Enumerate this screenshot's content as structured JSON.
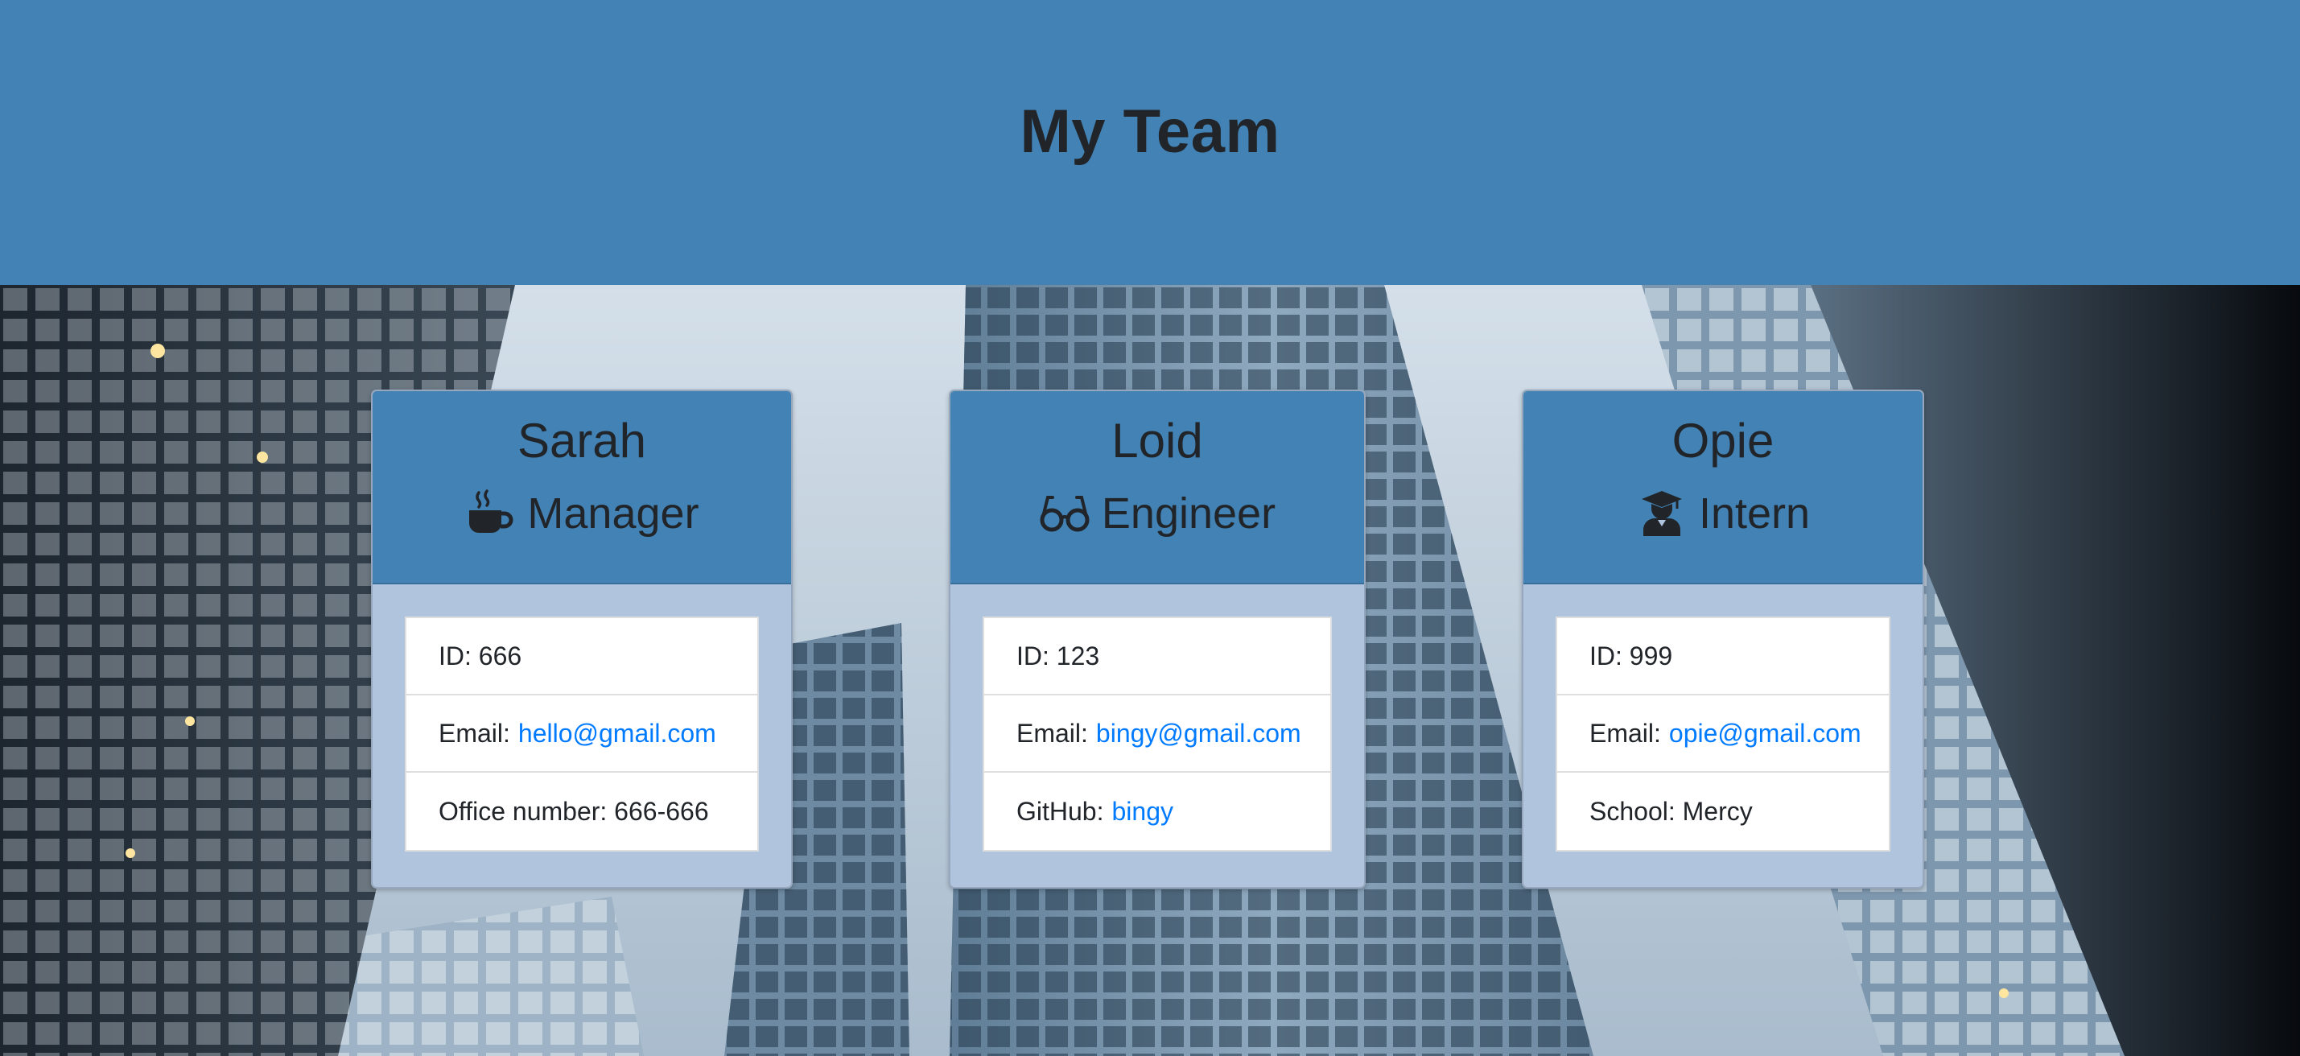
{
  "header": {
    "title": "My Team"
  },
  "team": [
    {
      "name": "Sarah",
      "role": "Manager",
      "icon": "mug-icon",
      "id_label": "ID:",
      "id": "666",
      "email_label": "Email:",
      "email": "hello@gmail.com",
      "extra_label": "Office number:",
      "extra_value": "666-666",
      "extra_is_link": false
    },
    {
      "name": "Loid",
      "role": "Engineer",
      "icon": "glasses-icon",
      "id_label": "ID:",
      "id": "123",
      "email_label": "Email:",
      "email": "bingy@gmail.com",
      "extra_label": "GitHub:",
      "extra_value": "bingy",
      "extra_is_link": true
    },
    {
      "name": "Opie",
      "role": "Intern",
      "icon": "graduate-icon",
      "id_label": "ID:",
      "id": "999",
      "email_label": "Email:",
      "email": "opie@gmail.com",
      "extra_label": "School:",
      "extra_value": "Mercy",
      "extra_is_link": false
    }
  ],
  "colors": {
    "header_bg": "#4282b4",
    "card_body_bg": "#b0c4de",
    "link": "#007bff",
    "text": "#212529"
  }
}
